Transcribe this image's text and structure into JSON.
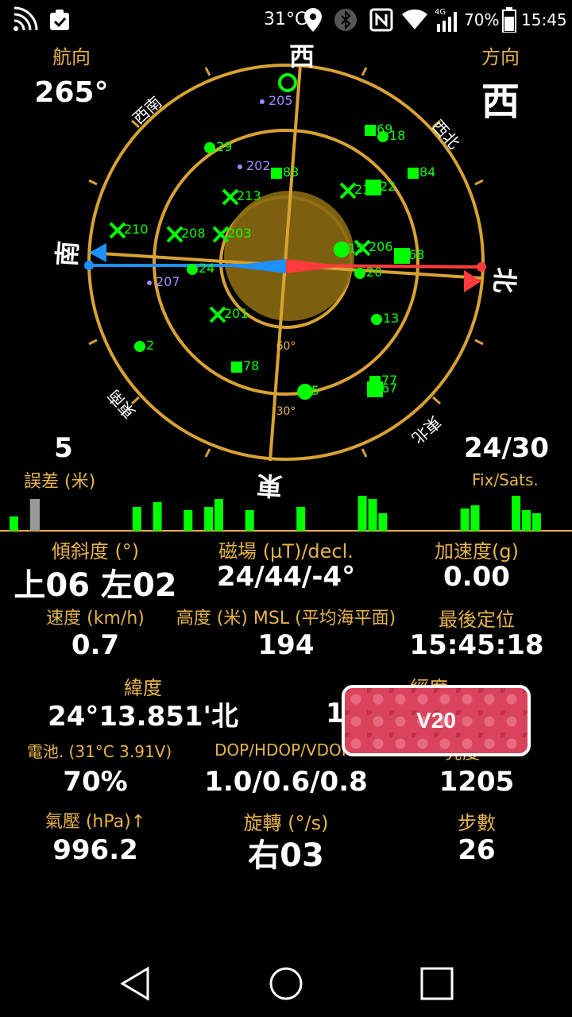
{
  "status_bar": {
    "temperature": "31°C",
    "battery_percent": "70%",
    "time": "15:45",
    "network": "4G",
    "icons": [
      "wifi-signal-icon",
      "clipboard-check-icon",
      "location-pin-icon",
      "bluetooth-icon",
      "nfc-icon",
      "wifi-icon",
      "cellular-icon",
      "battery-icon"
    ]
  },
  "compass": {
    "heading_label": "航向",
    "heading_value": "265°",
    "direction_label": "方向",
    "direction_value": "西",
    "cardinals": {
      "west": "西",
      "south": "南",
      "north": "北",
      "east": "東"
    },
    "intercardinals": {
      "sw": "西南",
      "nw": "西北",
      "se": "東南",
      "ne": "東北"
    },
    "ring_labels": {
      "r60": "60°",
      "r30": "30°"
    }
  },
  "satellites": [
    {
      "id": "205",
      "type": "dot-small"
    },
    {
      "id": "69",
      "type": "square"
    },
    {
      "id": "18",
      "type": "dot"
    },
    {
      "id": "29",
      "type": "dot"
    },
    {
      "id": "202",
      "type": "dot-small"
    },
    {
      "id": "83",
      "type": "square"
    },
    {
      "id": "84",
      "type": "square"
    },
    {
      "id": "213",
      "type": "cross"
    },
    {
      "id": "21",
      "type": "cross"
    },
    {
      "id": "22",
      "type": "square"
    },
    {
      "id": "210",
      "type": "cross"
    },
    {
      "id": "208",
      "type": "cross"
    },
    {
      "id": "203",
      "type": "cross"
    },
    {
      "id": "15",
      "type": "dot"
    },
    {
      "id": "206",
      "type": "cross"
    },
    {
      "id": "68",
      "type": "square"
    },
    {
      "id": "24",
      "type": "dot"
    },
    {
      "id": "20",
      "type": "dot"
    },
    {
      "id": "207",
      "type": "dot-small"
    },
    {
      "id": "13",
      "type": "dot"
    },
    {
      "id": "201",
      "type": "cross"
    },
    {
      "id": "2",
      "type": "dot"
    },
    {
      "id": "78",
      "type": "square"
    },
    {
      "id": "77",
      "type": "square"
    },
    {
      "id": "67",
      "type": "square"
    },
    {
      "id": "5",
      "type": "dot"
    }
  ],
  "accuracy": {
    "value": "5",
    "label": "誤差 (米)"
  },
  "fix": {
    "value": "24/30",
    "label": "Fix/Sats."
  },
  "signal_bars": [
    18,
    0,
    40,
    0,
    0,
    0,
    0,
    0,
    0,
    0,
    0,
    0,
    30,
    0,
    36,
    0,
    0,
    26,
    0,
    30,
    40,
    0,
    0,
    26,
    0,
    0,
    0,
    0,
    30,
    0,
    0,
    0,
    0,
    0,
    44,
    40,
    22,
    0,
    0,
    0,
    0,
    0,
    0,
    0,
    28,
    32,
    0,
    0,
    0,
    44,
    26,
    22
  ],
  "stats": {
    "tilt": {
      "label": "傾斜度 (°)",
      "value": "上06 左02"
    },
    "magnetic": {
      "label": "磁場 (µT)/decl.",
      "value": "24/44/-4°"
    },
    "acceleration": {
      "label": "加速度(g)",
      "value": "0.00"
    },
    "speed": {
      "label": "速度 (km/h)",
      "value": "0.7"
    },
    "altitude": {
      "label": "高度 (米) MSL (平均海平面)",
      "value": "194"
    },
    "last_fix": {
      "label": "最後定位",
      "value": "15:45:18"
    },
    "latitude": {
      "label": "緯度",
      "value": "24°13.851'北"
    },
    "longitude": {
      "label": "經度",
      "value": "1"
    },
    "battery": {
      "label": "電池. (31°C 3.91V)",
      "value": "70%"
    },
    "dop": {
      "label": "DOP/HDOP/VDOP",
      "value": "1.0/0.6/0.8"
    },
    "lux": {
      "label": "亮度",
      "value": "1205"
    },
    "pressure": {
      "label": "氣壓 (hPa)↑",
      "value": "996.2"
    },
    "rotation": {
      "label": "旋轉 (°/s)",
      "value": "右03"
    },
    "steps": {
      "label": "步數",
      "value": "26"
    }
  },
  "badge": {
    "label": "V20"
  },
  "nav": {
    "back": "back-icon",
    "home": "home-icon",
    "recents": "recents-icon"
  },
  "colors": {
    "gold": "#e6b34a",
    "green": "#00ff00",
    "red": "#ff3b3b",
    "blue": "#1e90ff",
    "purple": "#9b8cff",
    "ring": "#d8a233"
  }
}
